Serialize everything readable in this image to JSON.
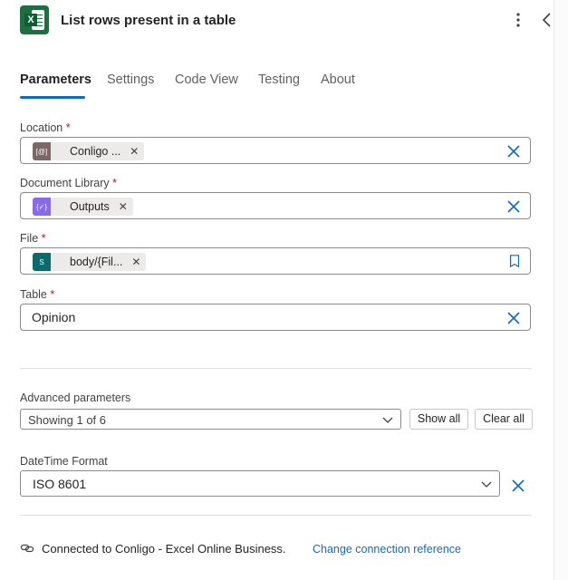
{
  "header": {
    "title": "List rows present in a table",
    "app_icon": "excel-icon"
  },
  "tabs": [
    {
      "label": "Parameters",
      "active": true
    },
    {
      "label": "Settings",
      "active": false
    },
    {
      "label": "Code View",
      "active": false
    },
    {
      "label": "Testing",
      "active": false
    },
    {
      "label": "About",
      "active": false
    }
  ],
  "fields": {
    "location": {
      "label": "Location",
      "required": "*",
      "token": "Conligo ...",
      "token_icon": "[@]"
    },
    "document_library": {
      "label": "Document Library",
      "required": "*",
      "token": "Outputs",
      "token_icon": "{✓}"
    },
    "file": {
      "label": "File",
      "required": "*",
      "token": "body/{Fil...",
      "token_icon": "S"
    },
    "table": {
      "label": "Table",
      "required": "*",
      "value": "Opinion"
    }
  },
  "advanced": {
    "label": "Advanced parameters",
    "select_value": "Showing 1 of 6",
    "show_all": "Show all",
    "clear_all": "Clear all"
  },
  "datetime": {
    "label": "DateTime Format",
    "value": "ISO 8601"
  },
  "connection": {
    "text": "Connected to Conligo - Excel Online Business.",
    "link": "Change connection reference"
  },
  "colors": {
    "accent": "#0f6cbd",
    "excel": "#1d6f42",
    "required": "#c50f1f"
  }
}
